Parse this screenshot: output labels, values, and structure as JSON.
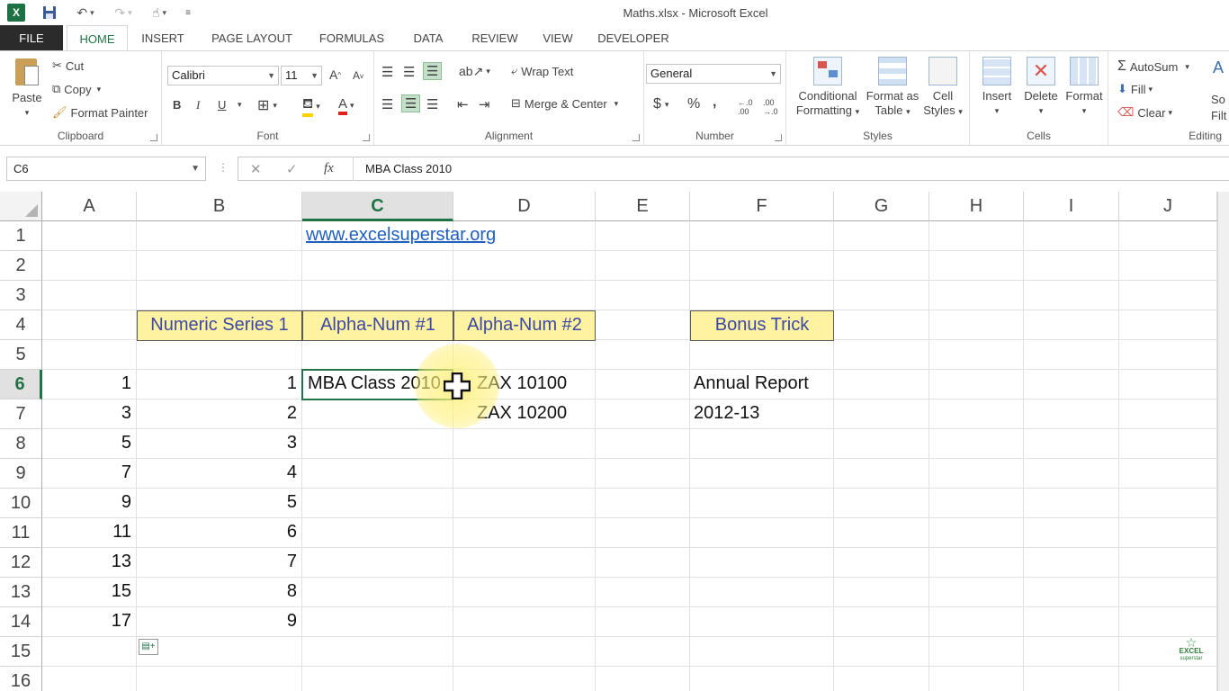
{
  "window": {
    "title": "Maths.xlsx - Microsoft Excel"
  },
  "qat": {
    "logo": "X"
  },
  "tabs": [
    {
      "label": "FILE"
    },
    {
      "label": "HOME"
    },
    {
      "label": "INSERT"
    },
    {
      "label": "PAGE LAYOUT"
    },
    {
      "label": "FORMULAS"
    },
    {
      "label": "DATA"
    },
    {
      "label": "REVIEW"
    },
    {
      "label": "VIEW"
    },
    {
      "label": "DEVELOPER"
    }
  ],
  "ribbon": {
    "clipboard": {
      "label": "Clipboard",
      "paste": "Paste",
      "cut": "Cut",
      "copy": "Copy",
      "format_painter": "Format Painter"
    },
    "font": {
      "label": "Font",
      "font_name": "Calibri",
      "font_size": "11",
      "bold": "B",
      "italic": "I",
      "underline": "U"
    },
    "alignment": {
      "label": "Alignment",
      "wrap_text": "Wrap Text",
      "merge_center": "Merge & Center"
    },
    "number": {
      "label": "Number",
      "format": "General",
      "currency": "$",
      "percent": "%",
      "comma": ","
    },
    "styles": {
      "label": "Styles",
      "conditional": "Conditional",
      "conditional2": "Formatting",
      "format_as": "Format as",
      "format_as2": "Table",
      "cell": "Cell",
      "cell2": "Styles"
    },
    "cells": {
      "label": "Cells",
      "insert": "Insert",
      "delete": "Delete",
      "format": "Format"
    },
    "editing": {
      "label": "Editing",
      "autosum": "AutoSum",
      "fill": "Fill",
      "clear": "Clear",
      "sort1": "So",
      "sort2": "Filt"
    }
  },
  "formula_bar": {
    "name_box": "C6",
    "fx": "fx",
    "value": "MBA Class 2010"
  },
  "grid": {
    "columns": [
      "A",
      "B",
      "C",
      "D",
      "E",
      "F",
      "G",
      "H",
      "I",
      "J"
    ],
    "selected_column": "C",
    "rows": [
      "1",
      "2",
      "3",
      "4",
      "5",
      "6",
      "7",
      "8",
      "9",
      "10",
      "11",
      "12",
      "13",
      "14",
      "15",
      "16"
    ],
    "selected_row": "6",
    "cells": {
      "C1": "www.excelsuperstar.org",
      "B4": "Numeric Series 1",
      "C4": "Alpha-Num #1",
      "D4": "Alpha-Num #2",
      "F4": "Bonus Trick",
      "A6": "1",
      "B6": "1",
      "C6": "MBA Class 2010",
      "D6": "ZAX 10100",
      "F6": "Annual Report",
      "A7": "3",
      "B7": "2",
      "D7": "ZAX 10200",
      "F7": "2012-13",
      "A8": "5",
      "B8": "3",
      "A9": "7",
      "B9": "4",
      "A10": "9",
      "B10": "5",
      "A11": "11",
      "B11": "6",
      "A12": "13",
      "B12": "7",
      "A13": "15",
      "B13": "8",
      "A14": "17",
      "B14": "9"
    }
  },
  "watermark": {
    "line1": "EXCEL",
    "line2": "superstar"
  },
  "colors": {
    "excel_green": "#217346",
    "header_fill": "#fff2a0",
    "header_text": "#3b48a8",
    "link": "#1f5fbf"
  }
}
